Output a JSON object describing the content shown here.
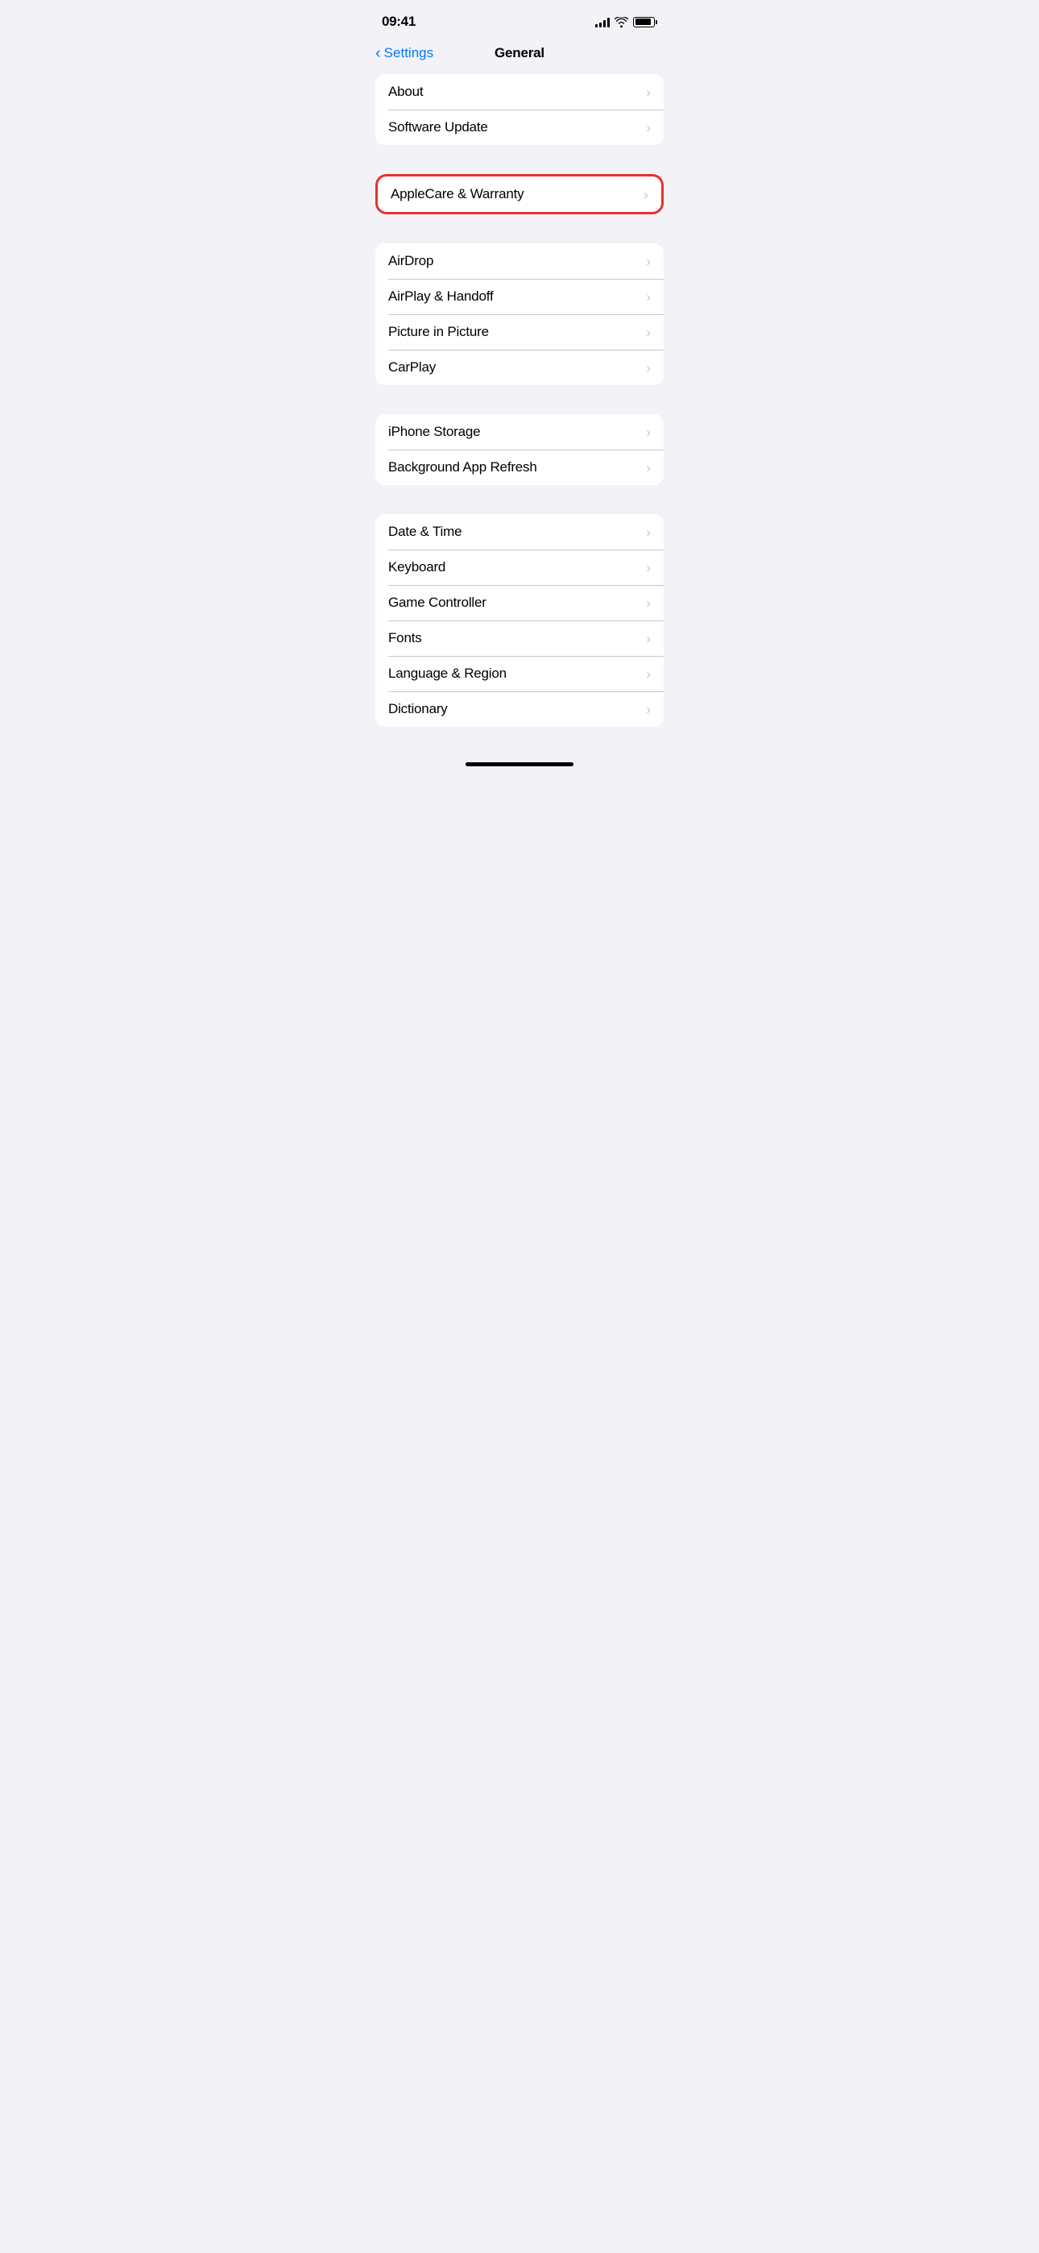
{
  "statusBar": {
    "time": "09:41",
    "signalBars": [
      4,
      6,
      8,
      10,
      12
    ],
    "batteryLevel": 90
  },
  "header": {
    "backLabel": "Settings",
    "title": "General"
  },
  "sections": [
    {
      "id": "section-1",
      "highlighted": false,
      "items": [
        {
          "id": "about",
          "label": "About"
        },
        {
          "id": "software-update",
          "label": "Software Update"
        }
      ]
    },
    {
      "id": "section-applecare",
      "highlighted": true,
      "items": [
        {
          "id": "applecare-warranty",
          "label": "AppleCare & Warranty"
        }
      ]
    },
    {
      "id": "section-2",
      "highlighted": false,
      "items": [
        {
          "id": "airdrop",
          "label": "AirDrop"
        },
        {
          "id": "airplay-handoff",
          "label": "AirPlay & Handoff"
        },
        {
          "id": "picture-in-picture",
          "label": "Picture in Picture"
        },
        {
          "id": "carplay",
          "label": "CarPlay"
        }
      ]
    },
    {
      "id": "section-3",
      "highlighted": false,
      "items": [
        {
          "id": "iphone-storage",
          "label": "iPhone Storage"
        },
        {
          "id": "background-app-refresh",
          "label": "Background App Refresh"
        }
      ]
    },
    {
      "id": "section-4",
      "highlighted": false,
      "items": [
        {
          "id": "date-time",
          "label": "Date & Time"
        },
        {
          "id": "keyboard",
          "label": "Keyboard"
        },
        {
          "id": "game-controller",
          "label": "Game Controller"
        },
        {
          "id": "fonts",
          "label": "Fonts"
        },
        {
          "id": "language-region",
          "label": "Language & Region"
        },
        {
          "id": "dictionary",
          "label": "Dictionary"
        }
      ]
    }
  ],
  "chevron": "›",
  "homeBar": {}
}
